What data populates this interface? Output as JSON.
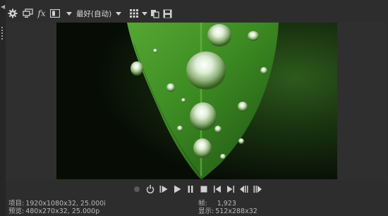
{
  "toolbar": {
    "icons": [
      "settings-gear-icon",
      "external-monitor-icon",
      "fx-icon",
      "split-view-icon",
      "grid-overlay-icon",
      "copy-snapshot-icon",
      "save-snapshot-icon"
    ],
    "fx_label": "fx",
    "preset_label": "最好(自动)"
  },
  "transport": {
    "buttons": [
      "record-icon",
      "loop-icon",
      "play-from-start-icon",
      "play-icon",
      "pause-icon",
      "stop-icon",
      "prev-frame-icon",
      "next-frame-icon",
      "prev-marker-icon",
      "next-marker-icon"
    ]
  },
  "info": {
    "project_label": "项目:",
    "project_value": "1920x1080x32, 25.000i",
    "preview_label": "预览:",
    "preview_value": "480x270x32, 25.000p",
    "frame_label": "帧:",
    "frame_value": "1,923",
    "display_label": "显示:",
    "display_value": "512x288x32"
  },
  "colors": {
    "bg": "#2d2d2d",
    "accent_leaf": "#3f8a24"
  }
}
